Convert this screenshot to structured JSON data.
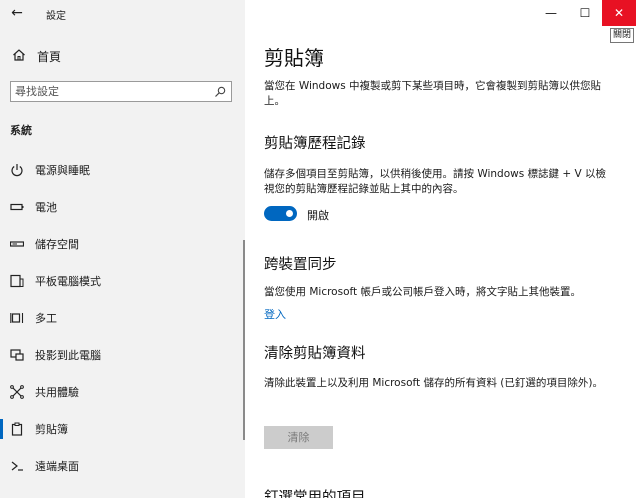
{
  "sidebar": {
    "app_title": "設定",
    "home_label": "首頁",
    "search": {
      "placeholder": "尋找設定"
    },
    "section_title": "系統",
    "items": [
      {
        "label": "電源與睡眠",
        "icon": "power-icon"
      },
      {
        "label": "電池",
        "icon": "battery-icon"
      },
      {
        "label": "儲存空間",
        "icon": "storage-icon"
      },
      {
        "label": "平板電腦模式",
        "icon": "tablet-mode-icon"
      },
      {
        "label": "多工",
        "icon": "multitasking-icon"
      },
      {
        "label": "投影到此電腦",
        "icon": "projecting-icon"
      },
      {
        "label": "共用體驗",
        "icon": "shared-experiences-icon"
      },
      {
        "label": "剪貼簿",
        "icon": "clipboard-icon",
        "active": true
      },
      {
        "label": "遠端桌面",
        "icon": "remote-desktop-icon"
      }
    ]
  },
  "window": {
    "close_tooltip": "關閉"
  },
  "main": {
    "title": "剪貼簿",
    "intro": "當您在 Windows 中複製或剪下某些項目時，它會複製到剪貼簿以供您貼上。",
    "history": {
      "heading": "剪貼簿歷程記錄",
      "desc": "儲存多個項目至剪貼簿，以供稍後使用。請按 Windows 標誌鍵 + V 以檢視您的剪貼簿歷程記錄並貼上其中的內容。",
      "toggle_state": "開啟"
    },
    "sync": {
      "heading": "跨裝置同步",
      "desc": "當您使用 Microsoft 帳戶或公司帳戶登入時，將文字貼上其他裝置。",
      "link": "登入"
    },
    "clear": {
      "heading": "清除剪貼簿資料",
      "desc": "清除此裝置上以及利用 Microsoft 儲存的所有資料 (已釘選的項目除外)。",
      "button": "清除"
    },
    "pinned_heading": "釘選常用的項目"
  },
  "colors": {
    "accent": "#0067c0",
    "close": "#e81123",
    "sidebar_bg": "#f2f2f2"
  }
}
